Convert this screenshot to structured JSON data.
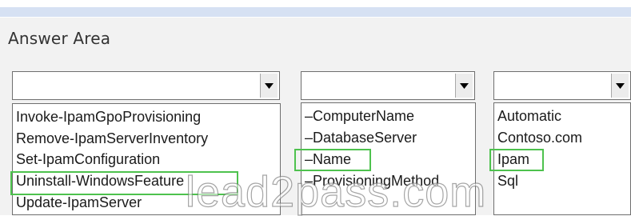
{
  "header": {
    "title": "Answer Area"
  },
  "dropdowns": [
    {
      "selected_value": "",
      "options": [
        {
          "label": "Invoke-IpamGpoProvisioning",
          "highlighted": false
        },
        {
          "label": "Remove-IpamServerInventory",
          "highlighted": false
        },
        {
          "label": "Set-IpamConfiguration",
          "highlighted": false
        },
        {
          "label": "Uninstall-WindowsFeature",
          "highlighted": true
        },
        {
          "label": "Update-IpamServer",
          "highlighted": false
        }
      ]
    },
    {
      "selected_value": "",
      "options": [
        {
          "label": "–ComputerName",
          "highlighted": false
        },
        {
          "label": "–DatabaseServer",
          "highlighted": false
        },
        {
          "label": "–Name",
          "highlighted": true
        },
        {
          "label": "–ProvisioningMethod",
          "highlighted": false
        }
      ]
    },
    {
      "selected_value": "",
      "options": [
        {
          "label": "Automatic",
          "highlighted": false
        },
        {
          "label": "Contoso.com",
          "highlighted": false
        },
        {
          "label": "Ipam",
          "highlighted": true
        },
        {
          "label": "Sql",
          "highlighted": false
        }
      ]
    }
  ],
  "watermark": {
    "text": "lead2pass.com"
  },
  "icons": {
    "dropdown_arrow": "chevron-down-icon"
  },
  "colors": {
    "header_band": "#d6e1f3",
    "panel_background": "#f2f2f2",
    "highlight_border": "#4ec24e"
  }
}
